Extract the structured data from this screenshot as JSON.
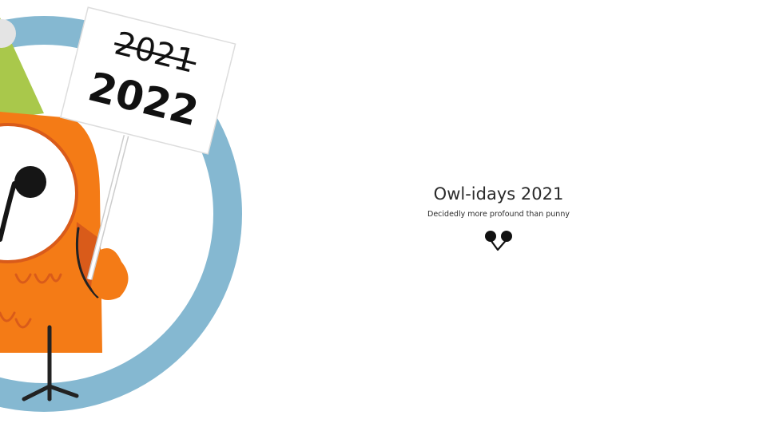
{
  "page": {
    "title": "Owl-idays 2021",
    "subtitle": "Decidedly more profound than punny"
  },
  "sign": {
    "old_year": "2021",
    "new_year": "2022"
  },
  "icons": {
    "owl_illustration": "owl-with-party-hat-holding-sign",
    "owl_eyes_logo": "owl-eyes-icon"
  },
  "colors": {
    "circle_ring": "#85b8d1",
    "owl_body": "#f47b16",
    "owl_accent": "#d95b1a",
    "party_hat": "#a9c84b",
    "text": "#2b2b2b"
  }
}
